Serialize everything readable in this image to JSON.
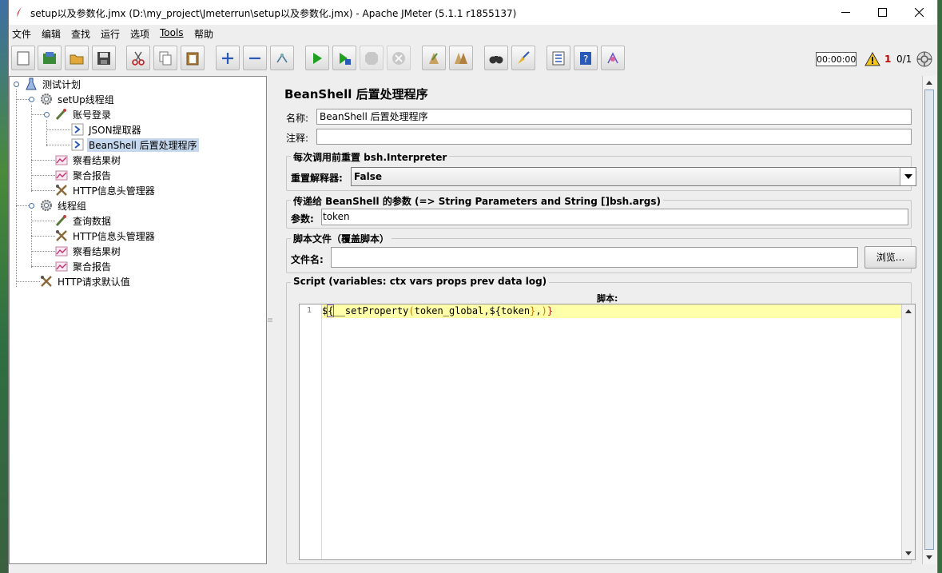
{
  "window": {
    "title": "setup以及参数化.jmx (D:\\my_project\\Jmeterrun\\setup以及参数化.jmx) - Apache JMeter (5.1.1 r1855137)"
  },
  "menu": [
    "文件",
    "编辑",
    "查找",
    "运行",
    "选项",
    "Tools",
    "帮助"
  ],
  "toolbar": {
    "buttons": [
      "new-icon",
      "templates-icon",
      "open-icon",
      "save-icon",
      "cut-icon",
      "copy-icon",
      "paste-icon",
      "expand-icon",
      "collapse-icon",
      "toggle-icon",
      "start-icon",
      "start-no-pause-icon",
      "stop-icon",
      "shutdown-icon",
      "clear-icon",
      "clear-all-icon",
      "search-icon",
      "reset-search-icon",
      "function-helper-icon",
      "help-icon",
      "logger-icon"
    ],
    "timer": "00:00:00",
    "warnings": "1",
    "threads": "0/1"
  },
  "tree": [
    {
      "label": "测试计划",
      "icon": "test-plan-icon"
    },
    {
      "label": "setUp线程组",
      "icon": "gear-icon"
    },
    {
      "label": "账号登录",
      "icon": "sampler-icon"
    },
    {
      "label": "JSON提取器",
      "icon": "postprocessor-icon"
    },
    {
      "label": "BeanShell 后置处理程序",
      "icon": "postprocessor-icon"
    },
    {
      "label": "察看结果树",
      "icon": "listener-icon"
    },
    {
      "label": "聚合报告",
      "icon": "listener-icon"
    },
    {
      "label": "HTTP信息头管理器",
      "icon": "config-icon"
    },
    {
      "label": "线程组",
      "icon": "gear-icon"
    },
    {
      "label": "查询数据",
      "icon": "sampler-icon"
    },
    {
      "label": "HTTP信息头管理器",
      "icon": "config-icon"
    },
    {
      "label": "察看结果树",
      "icon": "listener-icon"
    },
    {
      "label": "聚合报告",
      "icon": "listener-icon"
    },
    {
      "label": "HTTP请求默认值",
      "icon": "config-icon"
    }
  ],
  "editor": {
    "title": "BeanShell 后置处理程序",
    "name_label": "名称:",
    "name_value": "BeanShell 后置处理程序",
    "comment_label": "注释:",
    "comment_value": "",
    "reset_group_title": "每次调用前重置 bsh.Interpreter",
    "reset_label": "重置解释器:",
    "reset_value": "False",
    "params_group_title": "传递给 BeanShell 的参数 (=> String Parameters and String []bsh.args)",
    "params_label": "参数:",
    "params_value": "token",
    "file_group_title": "脚本文件（覆盖脚本）",
    "file_label": "文件名:",
    "file_value": "",
    "browse_label": "浏览...",
    "script_group_title": "Script (variables: ctx vars props prev data log)",
    "script_label": "脚本:",
    "line_number": "1",
    "code": {
      "p1": "$",
      "p2": "{",
      "p3": "__setProperty",
      "p4": "(",
      "p5": "token_global,",
      "p6": "${",
      "p7": "token",
      "p8": "}",
      "p9": ",",
      "p10": ")",
      "p11": "}"
    }
  },
  "colors": {
    "selection": "#c6d8ee",
    "code_highlight": "#ffffaa",
    "warning_count": "#c00000"
  }
}
